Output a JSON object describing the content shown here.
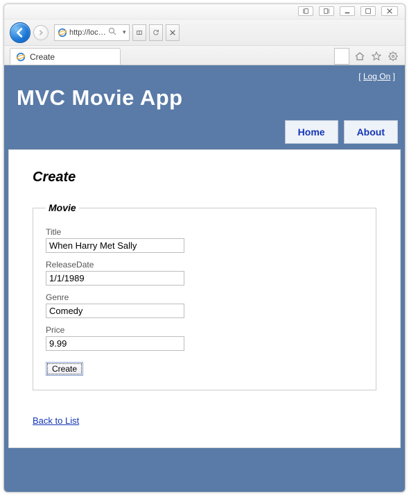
{
  "browser": {
    "address": "http://loc…",
    "search_hint": "",
    "tab_title": "Create"
  },
  "site": {
    "logon_label": "Log On",
    "title": "MVC Movie App",
    "nav": {
      "home": "Home",
      "about": "About"
    }
  },
  "page": {
    "heading": "Create",
    "legend": "Movie",
    "fields": {
      "title": {
        "label": "Title",
        "value": "When Harry Met Sally"
      },
      "releaseDate": {
        "label": "ReleaseDate",
        "value": "1/1/1989"
      },
      "genre": {
        "label": "Genre",
        "value": "Comedy"
      },
      "price": {
        "label": "Price",
        "value": "9.99"
      }
    },
    "submit_label": "Create",
    "back_label": "Back to List"
  }
}
